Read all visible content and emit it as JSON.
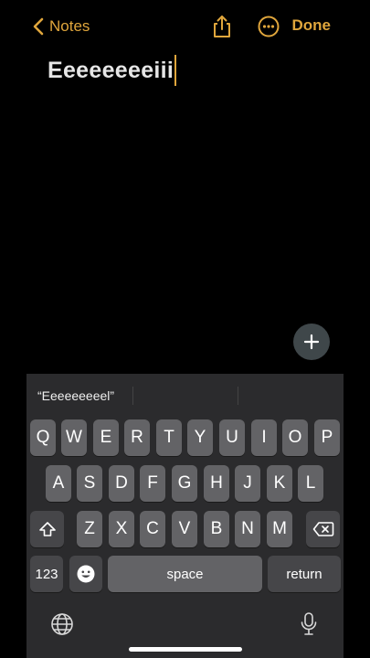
{
  "nav": {
    "back_label": "Notes",
    "done_label": "Done",
    "share_icon": "share-icon",
    "more_icon": "ellipsis-circle-icon",
    "accent": "#e0a63c"
  },
  "note": {
    "title": "Eeeeeeeeiii"
  },
  "fab": {
    "icon": "plus-icon"
  },
  "keyboard": {
    "suggestions": [
      "“Eeeeeeeeel”",
      "",
      ""
    ],
    "row1": [
      "Q",
      "W",
      "E",
      "R",
      "T",
      "Y",
      "U",
      "I",
      "O",
      "P"
    ],
    "row2": [
      "A",
      "S",
      "D",
      "F",
      "G",
      "H",
      "J",
      "K",
      "L"
    ],
    "row3": [
      "Z",
      "X",
      "C",
      "V",
      "B",
      "N",
      "M"
    ],
    "numbers_label": "123",
    "space_label": "space",
    "return_label": "return",
    "shift_icon": "shift-icon",
    "delete_icon": "delete-backspace-icon",
    "emoji_icon": "emoji-icon",
    "globe_icon": "globe-icon",
    "mic_icon": "microphone-icon"
  }
}
